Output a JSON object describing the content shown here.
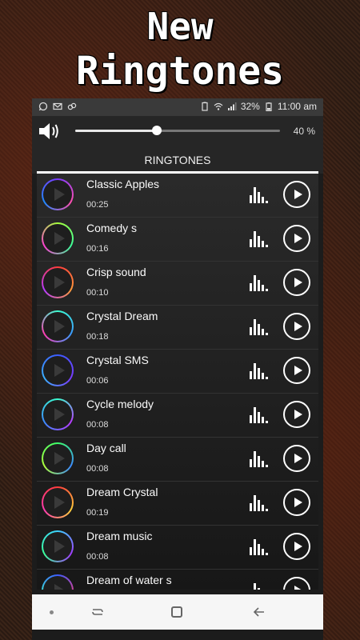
{
  "banner": {
    "line1": "New",
    "line2": "Ringtones"
  },
  "status_bar": {
    "battery_percent": "32%",
    "time": "11:00 am",
    "icons_left": [
      "whatsapp-icon",
      "mail-icon",
      "link-icon"
    ],
    "icons_right": [
      "battery-saver-icon",
      "wifi-icon",
      "signal-icon",
      "battery-icon"
    ]
  },
  "volume": {
    "level": 0.4,
    "label": "40 %"
  },
  "tab": {
    "label": "RINGTONES"
  },
  "ringtones": [
    {
      "name": "Classic Apples",
      "duration": "00:25",
      "ring_colors": [
        "#7b3bff",
        "#ff4fb0",
        "#1e88ff"
      ]
    },
    {
      "name": "Comedy s",
      "duration": "00:16",
      "ring_colors": [
        "#a6ff3b",
        "#3bff9a",
        "#ff3bd1"
      ]
    },
    {
      "name": "Crisp sound",
      "duration": "00:10",
      "ring_colors": [
        "#ff3b3b",
        "#ff9a3b",
        "#b53bff"
      ]
    },
    {
      "name": "Crystal Dream",
      "duration": "00:18",
      "ring_colors": [
        "#3bffd2",
        "#3b9aff",
        "#ff3bb0"
      ]
    },
    {
      "name": "Crystal SMS",
      "duration": "00:06",
      "ring_colors": [
        "#3b5bff",
        "#7a3bff",
        "#3bb0ff"
      ]
    },
    {
      "name": "Cycle melody",
      "duration": "00:08",
      "ring_colors": [
        "#3bffcf",
        "#b83bff",
        "#3b8aff"
      ]
    },
    {
      "name": "Day call",
      "duration": "00:08",
      "ring_colors": [
        "#3bff6a",
        "#3b8aff",
        "#b0ff3b"
      ]
    },
    {
      "name": "Dream Crystal",
      "duration": "00:19",
      "ring_colors": [
        "#ff3b3b",
        "#ffcf3b",
        "#ff3bb0"
      ]
    },
    {
      "name": "Dream music",
      "duration": "00:08",
      "ring_colors": [
        "#3bd2ff",
        "#a13bff",
        "#3bff9a"
      ]
    },
    {
      "name": "Dream of water s",
      "duration": "",
      "ring_colors": [
        "#3b5bff",
        "#ff3b7a",
        "#3bffcf"
      ]
    }
  ],
  "nav_bar": {
    "icons": [
      "dot-icon",
      "recent-apps-icon",
      "home-icon",
      "back-icon"
    ]
  },
  "colors": {
    "panel_bg": "#1c1c1c",
    "status_bg": "#3a3a3a",
    "accent": "#ffffff"
  }
}
